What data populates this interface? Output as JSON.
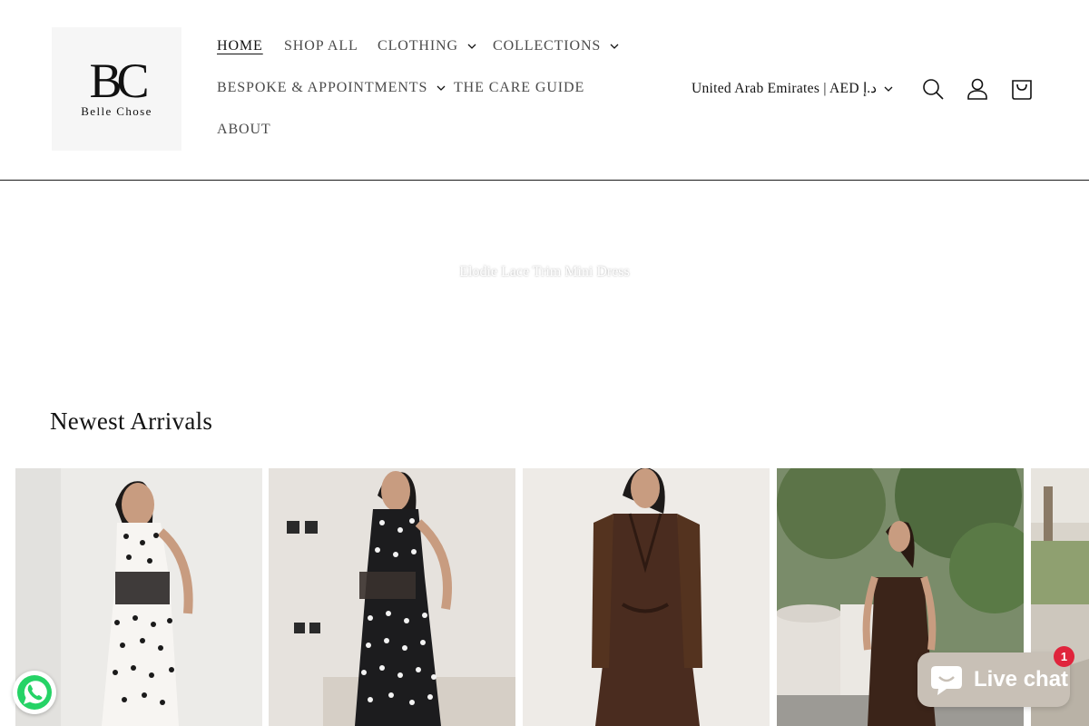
{
  "brand": {
    "logo_mark": "BC",
    "logo_text": "Belle Chose"
  },
  "nav": {
    "home": "HOME",
    "shop_all": "SHOP ALL",
    "clothing": "CLOTHING",
    "collections": "COLLECTIONS",
    "bespoke": "BESPOKE & APPOINTMENTS",
    "care_guide": "THE CARE GUIDE",
    "about": "ABOUT"
  },
  "locale": {
    "selected": "United Arab Emirates | AED د.إ"
  },
  "icons": {
    "search": "search-icon",
    "account": "account-icon",
    "cart": "cart-icon",
    "chevron": "chevron-down-icon",
    "whatsapp": "whatsapp-icon",
    "chat": "chat-bubble-icon"
  },
  "hero": {
    "caption": "Elodie Lace Trim Mini Dress"
  },
  "sections": {
    "newest_title": "Newest Arrivals"
  },
  "live_chat": {
    "label": "Live chat",
    "badge_count": "1"
  },
  "colors": {
    "text": "#121212",
    "nav_text": "#4a4a4a",
    "chat_bg": "#c8c0b6",
    "badge": "#e0243c",
    "whatsapp": "#25d366"
  }
}
